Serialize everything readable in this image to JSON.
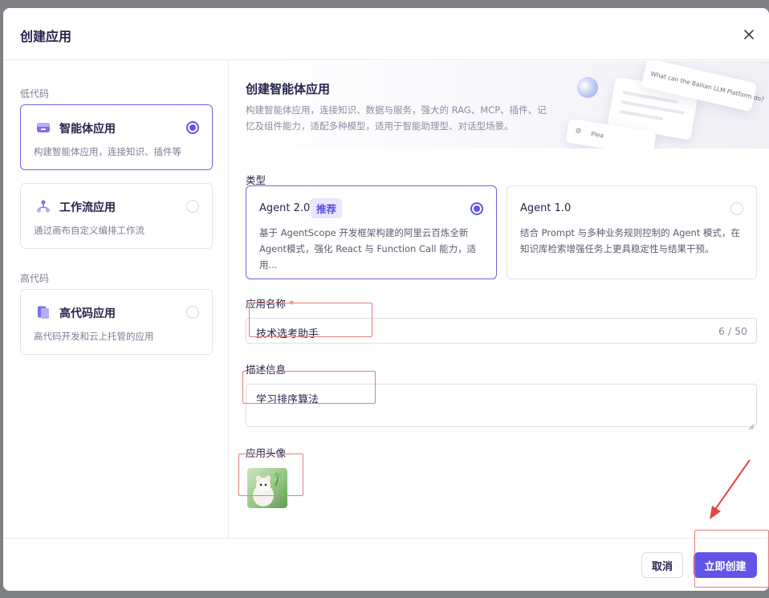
{
  "dialog": {
    "title": "创建应用",
    "close_icon": "close-icon"
  },
  "left_panel": {
    "low_code_label": "低代码",
    "high_code_label": "高代码",
    "cards": [
      {
        "title": "智能体应用",
        "desc": "构建智能体应用，连接知识、插件等",
        "icon": "agent-app-icon",
        "selected": true
      },
      {
        "title": "工作流应用",
        "desc": "通过画布自定义编排工作流",
        "icon": "workflow-icon",
        "selected": false
      },
      {
        "title": "高代码应用",
        "desc": "高代码开发和云上托管的应用",
        "icon": "high-code-icon",
        "selected": false
      }
    ]
  },
  "banner": {
    "title": "创建智能体应用",
    "desc": "构建智能体应用，连接知识、数据与服务，强大的 RAG、MCP、插件、记忆及组件能力，适配多种模型，适用于智能助理型、对话型场景。",
    "deco_prompt": "What can the Bailian LLM Platform do?",
    "deco_input_hint": "Plea"
  },
  "type_section": {
    "label": "类型",
    "options": [
      {
        "title": "Agent 2.0",
        "badge": "推荐",
        "desc": "基于 AgentScope 开发框架构建的阿里云百炼全新 Agent模式，强化 React 与 Function Call 能力，适用...",
        "selected": true
      },
      {
        "title": "Agent 1.0",
        "desc": "结合 Prompt 与多种业务规则控制的 Agent 模式，在知识库检索增强任务上更具稳定性与结果干预。",
        "selected": false
      }
    ]
  },
  "name_field": {
    "label": "应用名称",
    "required_mark": "*",
    "value": "技术选考助手",
    "counter": "6 / 50"
  },
  "desc_field": {
    "label": "描述信息",
    "value": "学习排序算法"
  },
  "avatar_field": {
    "label": "应用头像"
  },
  "footer": {
    "cancel_label": "取消",
    "create_label": "立即创建"
  },
  "colors": {
    "primary": "#6155e8",
    "annotation_red": "#e64545"
  }
}
